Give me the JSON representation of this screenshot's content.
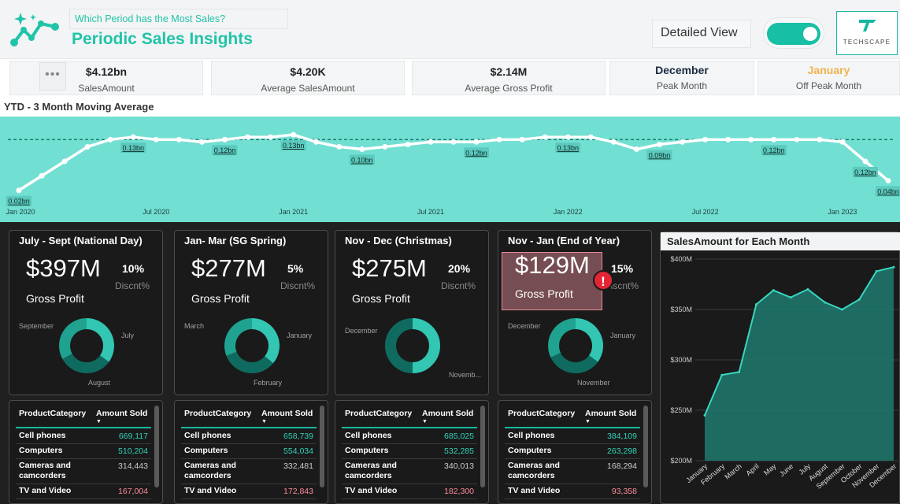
{
  "header": {
    "subtitle": "Which Period has the Most Sales?",
    "title": "Periodic Sales Insights",
    "detailed_view_label": "Detailed View",
    "toggle_on": true,
    "brand_text": "TECHSCAPE"
  },
  "colors": {
    "accent": "#20c4a8",
    "chart_panel": "#72dfd3",
    "dark_bg": "#202020",
    "donut_light": "#32c6b3",
    "donut_dark": "#0f6b5f",
    "amount_high": "#2fd3b8",
    "amount_mid": "#cccccc",
    "amount_low": "#ff8a9a",
    "off_peak": "#f2b24c"
  },
  "kpis": {
    "more_label": "•••",
    "sales_amount": {
      "value": "$4.12bn",
      "label": "SalesAmount"
    },
    "avg_sales": {
      "value": "$4.20K",
      "label": "Average SalesAmount"
    },
    "avg_gp": {
      "value": "$2.14M",
      "label": "Average Gross Profit"
    },
    "peak": {
      "value": "December",
      "label": "Peak Month"
    },
    "off_peak": {
      "value": "January",
      "label": "Off Peak Month"
    }
  },
  "ytd": {
    "title": "YTD - 3 Month Moving Average",
    "x_ticks": [
      "Jan 2020",
      "Jul 2020",
      "Jan 2021",
      "Jul 2021",
      "Jan 2022",
      "Jul 2022",
      "Jan 2023"
    ],
    "data_labels": [
      "0.02bn",
      "0.13bn",
      "0.12bn",
      "0.13bn",
      "0.10bn",
      "0.12bn",
      "0.13bn",
      "0.09bn",
      "0.12bn",
      "0.12bn",
      "0.04bn"
    ]
  },
  "chart_data": [
    {
      "type": "line",
      "title": "YTD - 3 Month Moving Average",
      "x": [
        "Jan 2020",
        "Feb 2020",
        "Mar 2020",
        "Apr 2020",
        "May 2020",
        "Jun 2020",
        "Jul 2020",
        "Aug 2020",
        "Sep 2020",
        "Oct 2020",
        "Nov 2020",
        "Dec 2020",
        "Jan 2021",
        "Feb 2021",
        "Mar 2021",
        "Apr 2021",
        "May 2021",
        "Jun 2021",
        "Jul 2021",
        "Aug 2021",
        "Sep 2021",
        "Oct 2021",
        "Nov 2021",
        "Dec 2021",
        "Jan 2022",
        "Feb 2022",
        "Mar 2022",
        "Apr 2022",
        "May 2022",
        "Jun 2022",
        "Jul 2022",
        "Aug 2022",
        "Sep 2022",
        "Oct 2022",
        "Nov 2022",
        "Dec 2022",
        "Jan 2023",
        "Feb 2023"
      ],
      "values": [
        0.02,
        0.05,
        0.08,
        0.11,
        0.125,
        0.13,
        0.125,
        0.125,
        0.12,
        0.125,
        0.13,
        0.13,
        0.135,
        0.12,
        0.11,
        0.105,
        0.11,
        0.115,
        0.12,
        0.12,
        0.12,
        0.125,
        0.125,
        0.13,
        0.13,
        0.13,
        0.12,
        0.105,
        0.115,
        0.12,
        0.125,
        0.125,
        0.125,
        0.125,
        0.125,
        0.125,
        0.12,
        0.08,
        0.04
      ],
      "average": 0.125,
      "unit": "bn"
    },
    {
      "type": "area",
      "title": "SalesAmount for Each Month",
      "categories": [
        "January",
        "February",
        "March",
        "April",
        "May",
        "June",
        "July",
        "August",
        "September",
        "October",
        "November",
        "December"
      ],
      "values": [
        245,
        285,
        288,
        355,
        369,
        362,
        370,
        357,
        350,
        360,
        388,
        392
      ],
      "y_ticks": [
        "$200M",
        "$250M",
        "$300M",
        "$350M",
        "$400M"
      ],
      "ylim": [
        200,
        400
      ],
      "grid": true
    }
  ],
  "cards": [
    {
      "title": "July - Sept (National Day)",
      "value": "$397M",
      "discount": "10%",
      "discount_label": "Discnt%",
      "gp_label": "Gross Profit",
      "donut_labels": [
        "September",
        "July",
        "August"
      ],
      "fractions": [
        0.35,
        0.32,
        0.33
      ],
      "alert": false
    },
    {
      "title": "Jan- Mar (SG Spring)",
      "value": "$277M",
      "discount": "5%",
      "discount_label": "Discnt%",
      "gp_label": "Gross Profit",
      "donut_labels": [
        "March",
        "January",
        "February"
      ],
      "fractions": [
        0.36,
        0.33,
        0.31
      ],
      "alert": false
    },
    {
      "title": "Nov - Dec (Christmas)",
      "value": "$275M",
      "discount": "20%",
      "discount_label": "Discnt%",
      "gp_label": "Gross Profit",
      "donut_labels": [
        "December",
        "Novemb..."
      ],
      "fractions": [
        0.5,
        0.5
      ],
      "alert": false
    },
    {
      "title": "Nov - Jan (End of Year)",
      "value": "$129M",
      "discount": "15%",
      "discount_label": "Discnt%",
      "gp_label": "Gross Profit",
      "donut_labels": [
        "December",
        "January",
        "November"
      ],
      "fractions": [
        0.35,
        0.33,
        0.32
      ],
      "alert": true
    }
  ],
  "tables": [
    {
      "col1": "ProductCategory",
      "col2": "Amount Sold",
      "rows": [
        {
          "category": "Cell phones",
          "amount": "669,117",
          "tone": "high"
        },
        {
          "category": "Computers",
          "amount": "510,204",
          "tone": "high"
        },
        {
          "category": "Cameras and camcorders",
          "amount": "314,443",
          "tone": "mid"
        },
        {
          "category": "TV and Video",
          "amount": "167,004",
          "tone": "low"
        }
      ]
    },
    {
      "col1": "ProductCategory",
      "col2": "Amount Sold",
      "rows": [
        {
          "category": "Cell phones",
          "amount": "658,739",
          "tone": "high"
        },
        {
          "category": "Computers",
          "amount": "554,034",
          "tone": "high"
        },
        {
          "category": "Cameras and camcorders",
          "amount": "332,481",
          "tone": "mid"
        },
        {
          "category": "TV and Video",
          "amount": "172,843",
          "tone": "low"
        }
      ]
    },
    {
      "col1": "ProductCategory",
      "col2": "Amount Sold",
      "rows": [
        {
          "category": "Cell phones",
          "amount": "685,025",
          "tone": "high"
        },
        {
          "category": "Computers",
          "amount": "532,285",
          "tone": "high"
        },
        {
          "category": "Cameras and camcorders",
          "amount": "340,013",
          "tone": "mid"
        },
        {
          "category": "TV and Video",
          "amount": "182,300",
          "tone": "low"
        }
      ]
    },
    {
      "col1": "ProductCategory",
      "col2": "Amount Sold",
      "rows": [
        {
          "category": "Cell phones",
          "amount": "384,109",
          "tone": "high"
        },
        {
          "category": "Computers",
          "amount": "263,298",
          "tone": "high"
        },
        {
          "category": "Cameras and camcorders",
          "amount": "168,294",
          "tone": "mid"
        },
        {
          "category": "TV and Video",
          "amount": "93,358",
          "tone": "low"
        }
      ]
    }
  ]
}
